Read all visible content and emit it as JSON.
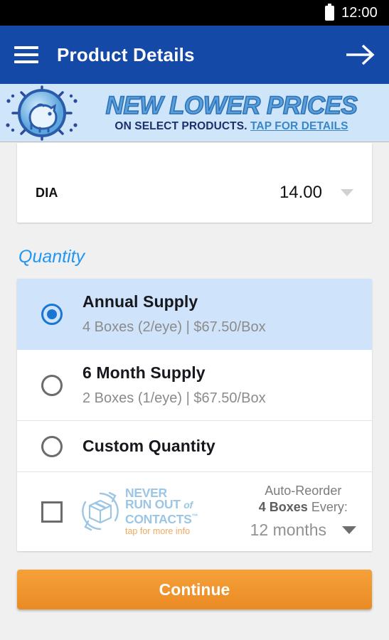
{
  "statusbar": {
    "time": "12:00",
    "battery_icon": "battery-full-icon"
  },
  "appbar": {
    "menu_icon": "hamburger-menu-icon",
    "title": "Product Details",
    "next_icon": "arrow-right-icon"
  },
  "promo": {
    "icon": "piggy-bank-icon",
    "headline": "NEW LOWER PRICES",
    "subline": "ON SELECT PRODUCTS. ",
    "link": "TAP FOR DETAILS"
  },
  "spec": {
    "label": "DIA",
    "value": "14.00",
    "caret_icon": "chevron-down-icon"
  },
  "quantity": {
    "title": "Quantity",
    "options": [
      {
        "title": "Annual Supply",
        "sub": "4 Boxes (2/eye) | $67.50/Box",
        "selected": true
      },
      {
        "title": "6 Month Supply",
        "sub": "2 Boxes (1/eye) | $67.50/Box",
        "selected": false
      },
      {
        "title": "Custom Quantity",
        "sub": "",
        "selected": false
      }
    ]
  },
  "auto_reorder": {
    "checkbox_icon": "checkbox-unchecked-icon",
    "brand_icon": "recycling-box-icon",
    "brand_line1": "NEVER",
    "brand_line2a": "RUN OUT ",
    "brand_line2b": "of",
    "brand_line3": "CONTACTS",
    "brand_tm": "™",
    "tap_text": "tap for more info",
    "label_line1": "Auto-Reorder",
    "label_qty": "4 Boxes",
    "label_every": " Every:",
    "interval_value": "12 months",
    "interval_caret_icon": "chevron-down-icon"
  },
  "footer": {
    "continue_label": "Continue"
  },
  "colors": {
    "appbar": "#1549a8",
    "accent_blue": "#2196f3",
    "selected_row": "#cfe4fb",
    "promo_bg": "#cfe6fa",
    "continue_orange": "#ea8b24",
    "tap_orange": "#f0a85e"
  }
}
